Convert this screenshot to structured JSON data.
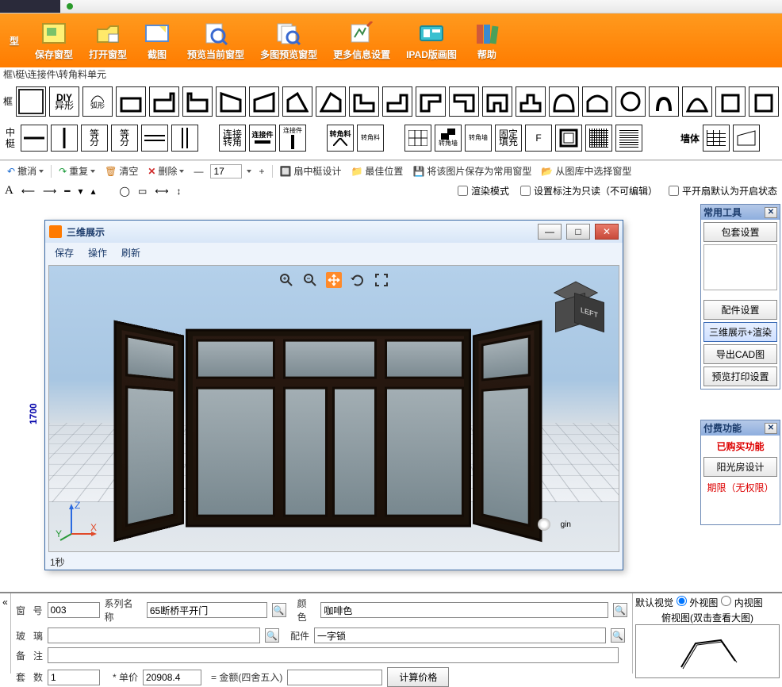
{
  "topbar": {
    "tab1": "…",
    "tab2": "…"
  },
  "ribbon": [
    {
      "label": "型",
      "hasLeft": true
    },
    {
      "label": "保存窗型"
    },
    {
      "label": "打开窗型"
    },
    {
      "label": "截图"
    },
    {
      "label": "预览当前窗型"
    },
    {
      "label": "多图预览窗型"
    },
    {
      "label": "更多信息设置"
    },
    {
      "label": "IPAD版画图"
    },
    {
      "label": "帮助"
    }
  ],
  "crumb": "框\\梃\\连接件\\转角料单元",
  "palette": {
    "row1_label": "框",
    "row2_label": "中梃",
    "row2_items": [
      "",
      "等分",
      "等分",
      "",
      "",
      "",
      "连接转角",
      "连接件",
      "连接件",
      "转角料",
      "转角料",
      "",
      "转角墙",
      "转角墙",
      "固定填充",
      "F",
      "",
      "",
      "",
      "墙体",
      "",
      ""
    ]
  },
  "toolbar2": {
    "undo": "撤消",
    "redo": "重复",
    "clear": "清空",
    "delete": "删除",
    "num": "17",
    "mid_design": "扇中梃设计",
    "best_pos": "最佳位置",
    "save_common": "将该图片保存为常用窗型",
    "from_lib": "从图库中选择窗型"
  },
  "toolbar3": {
    "letter": "A",
    "chk_render": "渲染模式",
    "chk_readonly": "设置标注为只读（不可编辑）",
    "chk_open": "平开扇默认为开启状态"
  },
  "dim_y": "1700",
  "side1": {
    "title": "常用工具",
    "btn1": "包套设置",
    "btn2": "配件设置",
    "btn3": "三维展示+渲染",
    "btn4": "导出CAD图",
    "btn5": "预览打印设置"
  },
  "side2": {
    "title": "付费功能",
    "bought": "已购买功能",
    "btn1": "阳光房设计",
    "limit": "期限（无权限）"
  },
  "win3d": {
    "title": "三维展示",
    "menu": [
      "保存",
      "操作",
      "刷新"
    ],
    "status": "1秒",
    "cube": "LEFT",
    "origin": "gin",
    "axes": {
      "x": "X",
      "y": "Y",
      "z": "Z"
    }
  },
  "form": {
    "win_no_label": "窗号",
    "win_no": "003",
    "series_label": "系列名称",
    "series": "65断桥平开门",
    "color_label": "颜色",
    "color": "咖啡色",
    "glass_label": "玻璃",
    "glass": "",
    "part_label": "配件",
    "part": "一字锁",
    "note_label": "备注",
    "note": "",
    "qty_label": "套数",
    "qty": "1",
    "unit_label": "* 单价",
    "unit": "20908.4",
    "total_label": "= 金额(四舍五入)",
    "calc": "计算价格"
  },
  "viewer": {
    "default": "默认视觉",
    "outer": "外视图",
    "inner": "内视图",
    "plan": "俯视图(双击查看大图)"
  }
}
